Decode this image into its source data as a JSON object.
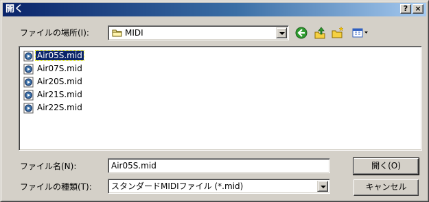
{
  "window": {
    "title": "開く",
    "help_button": "?",
    "close_button": "×"
  },
  "location": {
    "label": "ファイルの場所(I):",
    "folder": "MIDI",
    "folder_icon": "folder-icon"
  },
  "toolbar": {
    "icons": [
      "back-icon",
      "up-folder-icon",
      "new-folder-icon",
      "view-menu-icon"
    ]
  },
  "files": [
    {
      "name": "Air05S.mid",
      "selected": true
    },
    {
      "name": "Air07S.mid",
      "selected": false
    },
    {
      "name": "Air20S.mid",
      "selected": false
    },
    {
      "name": "Air21S.mid",
      "selected": false
    },
    {
      "name": "Air22S.mid",
      "selected": false
    }
  ],
  "filename": {
    "label": "ファイル名(N):",
    "value": "Air05S.mid"
  },
  "filetype": {
    "label": "ファイルの種類(T):",
    "value": "スタンダードMIDIファイル (*.mid)"
  },
  "buttons": {
    "open": "開く(O)",
    "cancel": "キャンセル"
  },
  "colors": {
    "titlebar_start": "#0a246a",
    "titlebar_end": "#a6caf0",
    "face": "#d4d0c8",
    "selection": "#0a246a"
  }
}
